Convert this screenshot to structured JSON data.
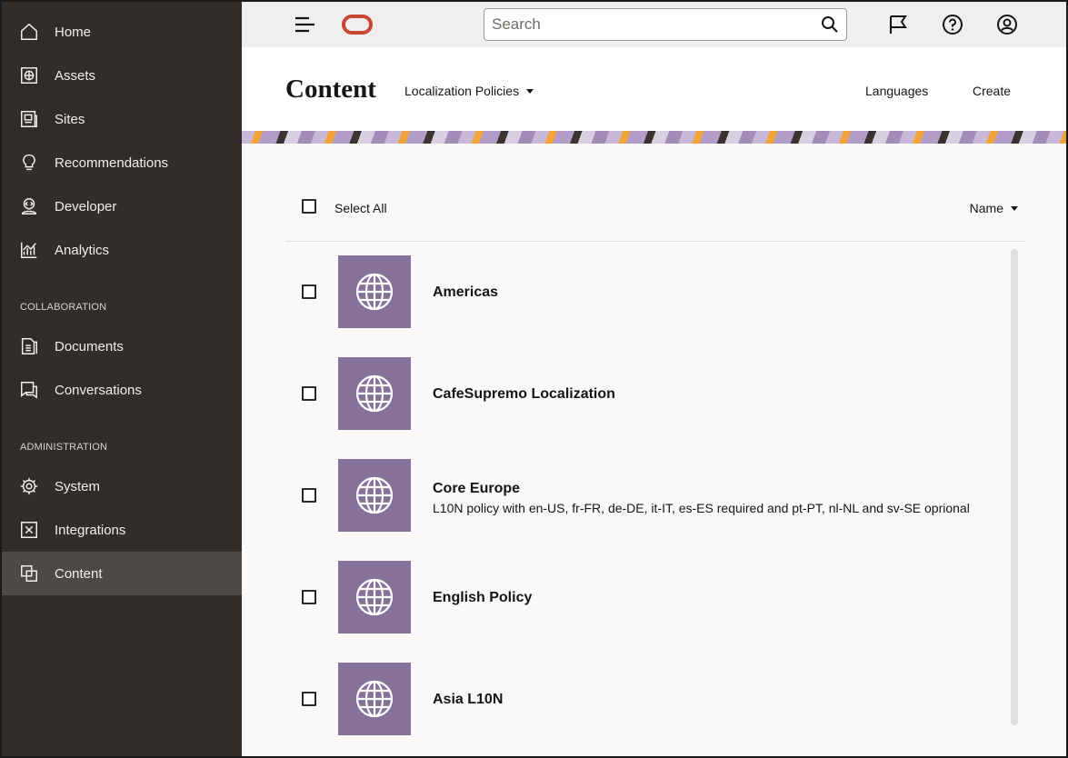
{
  "sidebar": {
    "items": [
      {
        "label": "Home",
        "icon": "home-icon"
      },
      {
        "label": "Assets",
        "icon": "assets-icon"
      },
      {
        "label": "Sites",
        "icon": "sites-icon"
      },
      {
        "label": "Recommendations",
        "icon": "lightbulb-icon"
      },
      {
        "label": "Developer",
        "icon": "developer-icon"
      },
      {
        "label": "Analytics",
        "icon": "analytics-icon"
      }
    ],
    "collaboration_label": "COLLABORATION",
    "collaboration_items": [
      {
        "label": "Documents",
        "icon": "documents-icon"
      },
      {
        "label": "Conversations",
        "icon": "conversations-icon"
      }
    ],
    "administration_label": "ADMINISTRATION",
    "administration_items": [
      {
        "label": "System",
        "icon": "gear-icon"
      },
      {
        "label": "Integrations",
        "icon": "integrations-icon"
      },
      {
        "label": "Content",
        "icon": "content-icon",
        "active": true
      }
    ]
  },
  "topbar": {
    "search_placeholder": "Search"
  },
  "header": {
    "title": "Content",
    "dropdown_label": "Localization Policies",
    "languages_label": "Languages",
    "create_label": "Create"
  },
  "toolbar": {
    "select_all_label": "Select All",
    "sort_label": "Name"
  },
  "policies": [
    {
      "name": "Americas",
      "description": ""
    },
    {
      "name": "CafeSupremo Localization",
      "description": ""
    },
    {
      "name": "Core Europe",
      "description": "L10N policy with en-US, fr-FR, de-DE, it-IT, es-ES required and pt-PT, nl-NL and sv-SE oprional"
    },
    {
      "name": "English Policy",
      "description": ""
    },
    {
      "name": "Asia L10N",
      "description": ""
    }
  ],
  "colors": {
    "sidebar_bg": "#312d2a",
    "sidebar_active": "#4f4945",
    "oracle_red": "#c74634",
    "thumb_purple": "#86719b"
  }
}
